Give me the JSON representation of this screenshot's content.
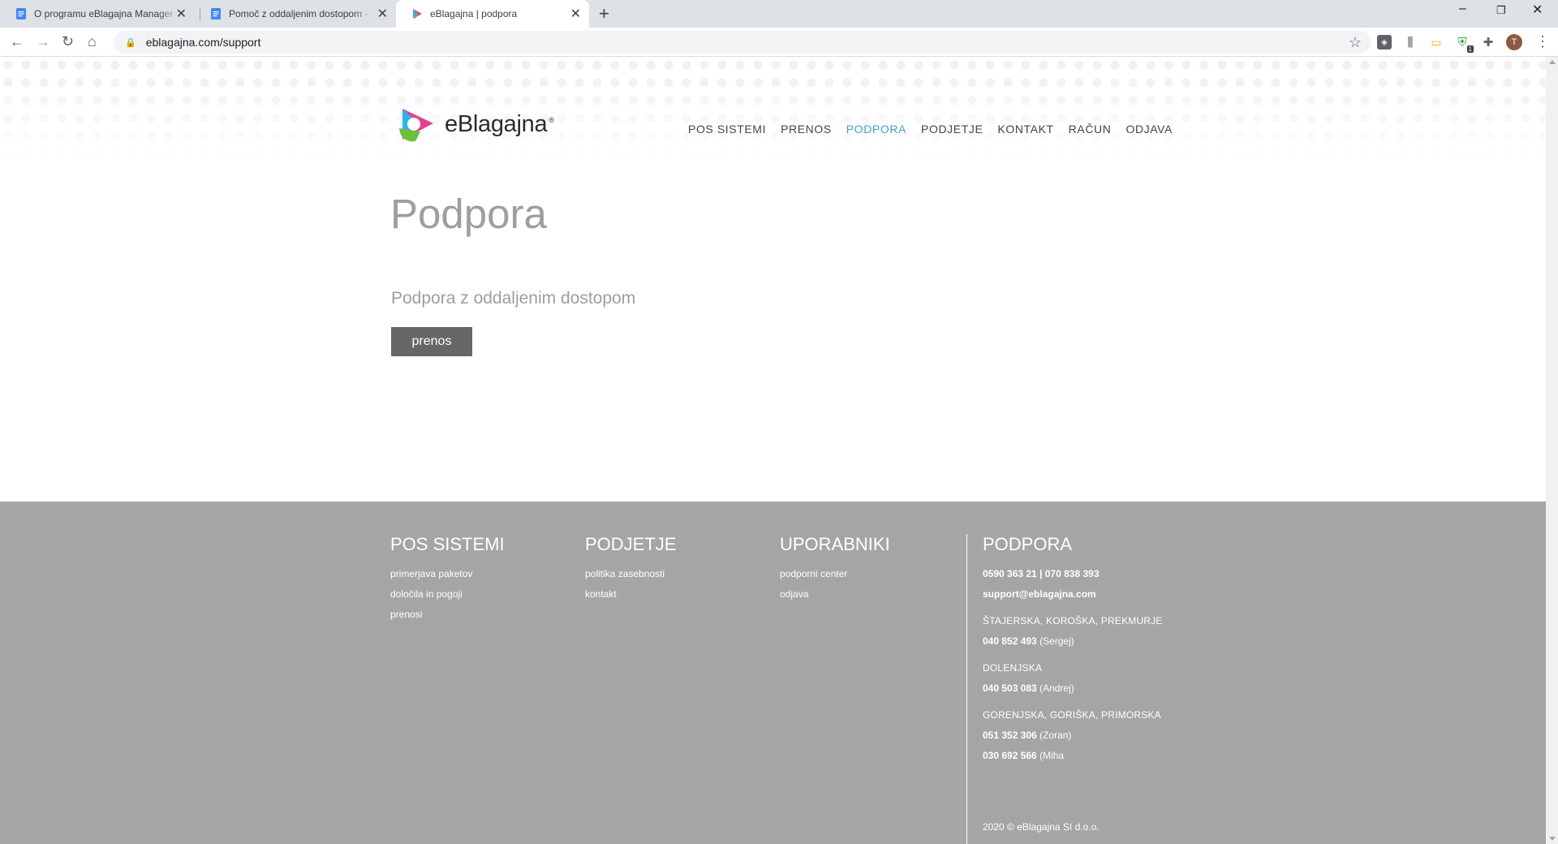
{
  "browser": {
    "tabs": [
      {
        "title": "O programu eBlagajna Manager"
      },
      {
        "title": "Pomoč z oddaljenim dostopom - "
      },
      {
        "title": "eBlagajna | podpora"
      }
    ],
    "new_tab": "+",
    "window_controls": {
      "minimize": "–",
      "restore": "❐",
      "close": "✕"
    },
    "url": "eblagajna.com/support",
    "avatar_letter": "T",
    "extension_badge": "1"
  },
  "site": {
    "brand": "eBlagajna",
    "brand_mark": "®",
    "nav": [
      {
        "label": "POS SISTEMI"
      },
      {
        "label": "PRENOS"
      },
      {
        "label": "PODPORA"
      },
      {
        "label": "PODJETJE"
      },
      {
        "label": "KONTAKT"
      },
      {
        "label": "RAČUN"
      },
      {
        "label": "ODJAVA"
      }
    ],
    "active_color": "#3fa2cc"
  },
  "main": {
    "page_title": "Podpora",
    "section_title": "Podpora z oddaljenim dostopom",
    "button_label": "prenos"
  },
  "footer": {
    "pos": {
      "heading": "POS SISTEMI",
      "links": [
        "primerjava paketov",
        "določila in pogoji",
        "prenosi"
      ]
    },
    "company": {
      "heading": "PODJETJE",
      "links": [
        "politika zasebnosti",
        "kontakt"
      ]
    },
    "users": {
      "heading": "UPORABNIKI",
      "links": [
        "podporni center",
        "odjava"
      ]
    },
    "support": {
      "heading": "PODPORA",
      "phones": "0590 363 21 | 070 838 393",
      "email": "support@eblagajna.com",
      "regions": [
        {
          "name": "ŠTAJERSKA, KOROŠKA, PREKMURJE",
          "contacts": [
            {
              "phone": "040 852 493",
              "person": "(Sergej)"
            }
          ]
        },
        {
          "name": "DOLENJSKA",
          "contacts": [
            {
              "phone": "040 503 083",
              "person": "(Andrej)"
            }
          ]
        },
        {
          "name": "GORENJSKA, GORIŠKA, PRIMORSKA",
          "contacts": [
            {
              "phone": "051 352 306",
              "person": "(Zoran)"
            },
            {
              "phone": "030 692 566",
              "person": "(Miha"
            }
          ]
        }
      ]
    },
    "copyright": "2020 © eBlagajna SI d.o.o."
  }
}
